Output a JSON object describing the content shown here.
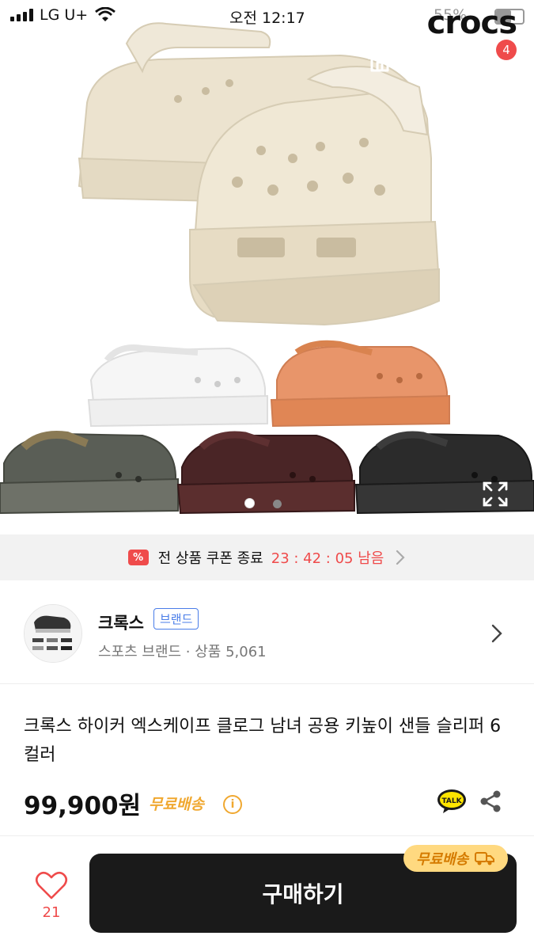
{
  "status_bar": {
    "carrier": "LG U+",
    "time": "오전 12:17",
    "battery": "55%"
  },
  "hero": {
    "brand_logo": "crocs",
    "cart_count": "4",
    "gallery_page": 1,
    "gallery_total": 2
  },
  "coupon": {
    "badge": "%",
    "text": "전 상품 쿠폰 종료",
    "timer": "23 : 42 : 05 남음"
  },
  "seller": {
    "name": "크록스",
    "tag": "브랜드",
    "subtitle": "스포츠 브랜드 · 상품 5,061"
  },
  "product": {
    "title": "크록스 하이커 엑스케이프 클로그 남녀 공용 키높이 샌들 슬리퍼 6컬러",
    "price": "99,900원",
    "shipping": "무료배송",
    "info_icon": "i",
    "talk_label": "TALK"
  },
  "bottom_bar": {
    "like_count": "21",
    "buy_label": "구매하기",
    "shipping_badge": "무료배송"
  },
  "colors": {
    "accent_red": "#ef4b4b",
    "shipping_orange": "#f0a830",
    "brand_blue": "#4a7de8",
    "buy_button": "#1a1a1a"
  }
}
